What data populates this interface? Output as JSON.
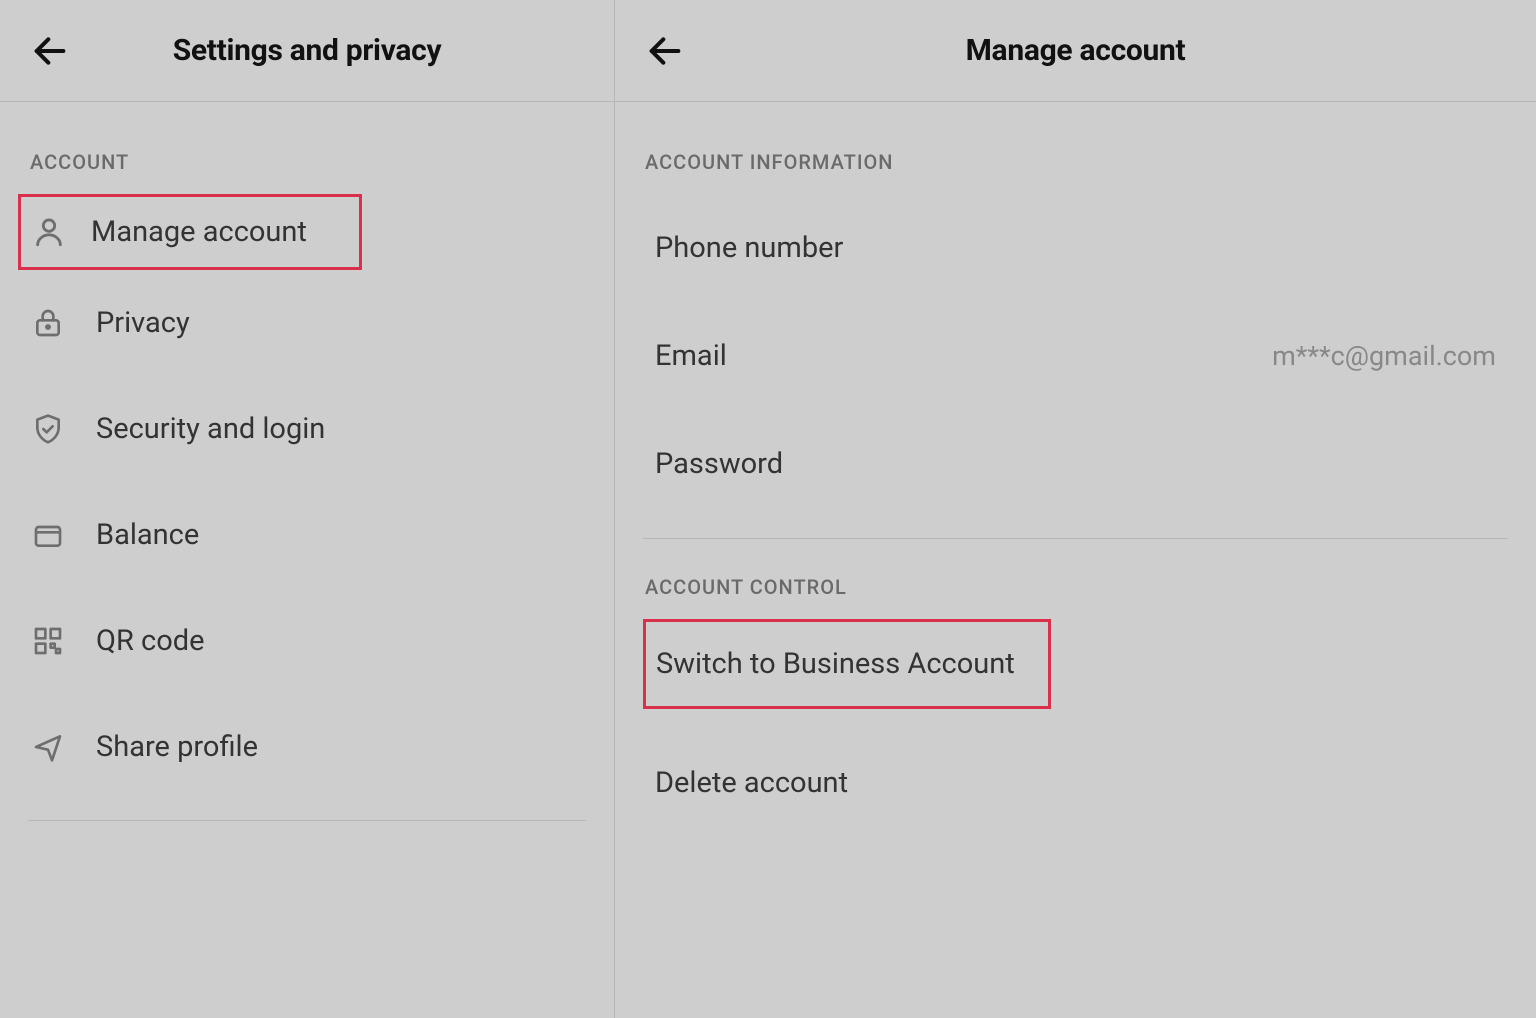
{
  "left": {
    "title": "Settings and privacy",
    "section_account": "ACCOUNT",
    "items": {
      "manage_account": "Manage account",
      "privacy": "Privacy",
      "security": "Security and login",
      "balance": "Balance",
      "qr_code": "QR code",
      "share_profile": "Share profile"
    }
  },
  "right": {
    "title": "Manage account",
    "section_info": "ACCOUNT INFORMATION",
    "section_control": "ACCOUNT CONTROL",
    "items": {
      "phone": "Phone number",
      "email": "Email",
      "email_value": "m***c@gmail.com",
      "password": "Password",
      "switch_business": "Switch to Business Account",
      "delete_account": "Delete account"
    }
  }
}
